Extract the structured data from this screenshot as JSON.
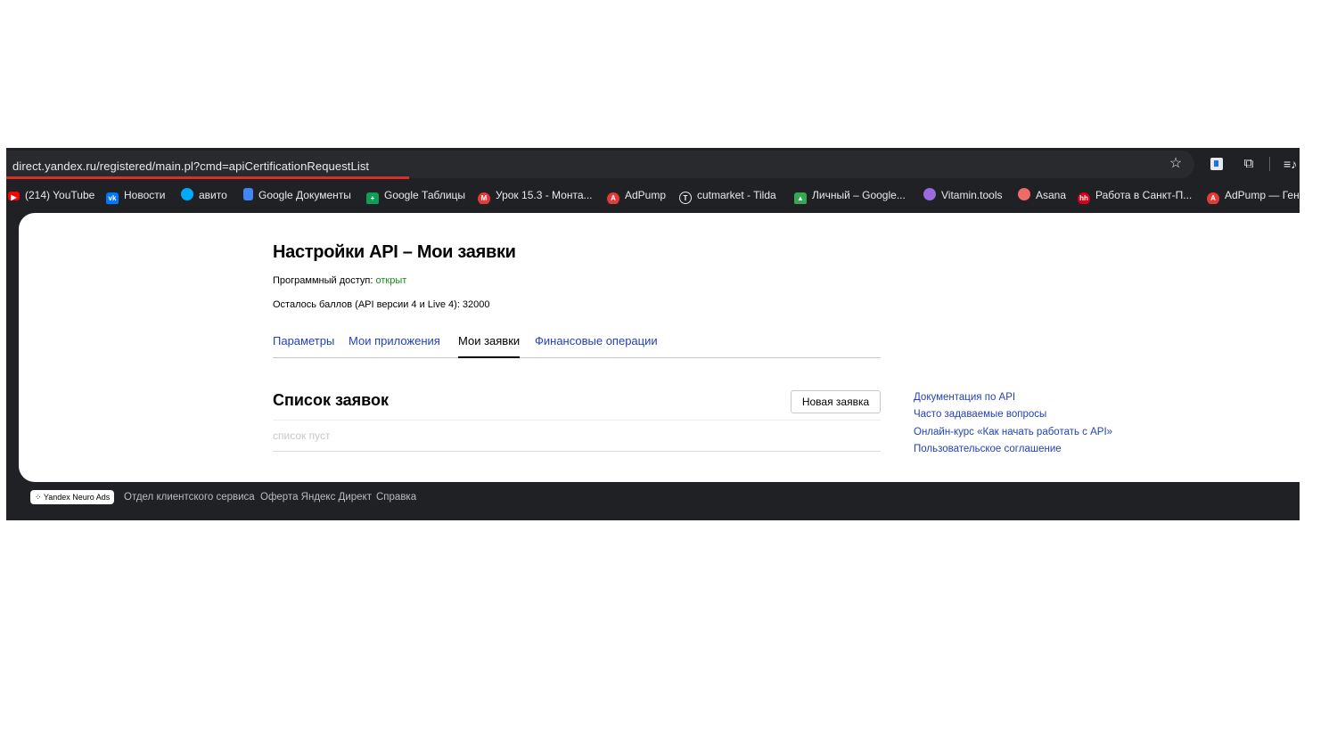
{
  "browser": {
    "url": "direct.yandex.ru/registered/main.pl?cmd=apiCertificationRequestList",
    "icons": [
      "star-icon",
      "extension-icon",
      "puzzle-icon",
      "media-icon"
    ]
  },
  "bookmarks": [
    {
      "label": "(214) YouTube",
      "icon": "youtube-icon",
      "color": "#ff0000"
    },
    {
      "label": "Новости",
      "icon": "vk-icon",
      "color": "#0077ff"
    },
    {
      "label": "авито",
      "icon": "avito-icon",
      "color": "#00aaff"
    },
    {
      "label": "Google Документы",
      "icon": "google-docs-icon",
      "color": "#4285f4"
    },
    {
      "label": "Google Таблицы",
      "icon": "google-sheets-icon",
      "color": "#0f9d58"
    },
    {
      "label": "Урок 15.3 - Монта...",
      "icon": "lesson-icon",
      "color": "#e53935"
    },
    {
      "label": "AdPump",
      "icon": "adpump-icon",
      "color": "#e53935"
    },
    {
      "label": "cutmarket - Tilda",
      "icon": "tilda-icon",
      "color": "#3c3c3c"
    },
    {
      "label": "Личный – Google...",
      "icon": "google-drive-icon",
      "color": "#34a853"
    },
    {
      "label": "Vitamin.tools",
      "icon": "vitamin-icon",
      "color": "#9c6ade"
    },
    {
      "label": "Asana",
      "icon": "asana-icon",
      "color": "#f06a6a"
    },
    {
      "label": "Работа в Санкт-П...",
      "icon": "hh-icon",
      "color": "#d6001c"
    },
    {
      "label": "AdPump — Гене",
      "icon": "adpump-icon",
      "color": "#e53935"
    }
  ],
  "page": {
    "title": "Настройки API – Мои заявки",
    "access_label": "Программный доступ:",
    "access_status": "открыт",
    "points_line": "Осталось баллов (API версии 4 и Live 4): 32000",
    "tabs": [
      {
        "label": "Параметры",
        "active": false
      },
      {
        "label": "Мои приложения",
        "active": false
      },
      {
        "label": "Мои заявки",
        "active": true
      },
      {
        "label": "Финансовые операции",
        "active": false
      }
    ],
    "list_title": "Список заявок",
    "new_request_label": "Новая заявка",
    "empty_text": "список пуст",
    "side_links": [
      "Документация по API",
      "Часто задаваемые вопросы",
      "Онлайн-курс «Как начать работать с API»",
      "Пользовательское соглашение"
    ]
  },
  "footer": {
    "badge": "Yandex Neuro Ads",
    "links": [
      "Отдел клиентского сервиса",
      "Оферта Яндекс Директ",
      "Справка"
    ]
  },
  "colors": {
    "link": "#2442b5",
    "status_open": "#1a8a1a",
    "browser_bg": "#202124",
    "loading_bar": "#d93025"
  }
}
